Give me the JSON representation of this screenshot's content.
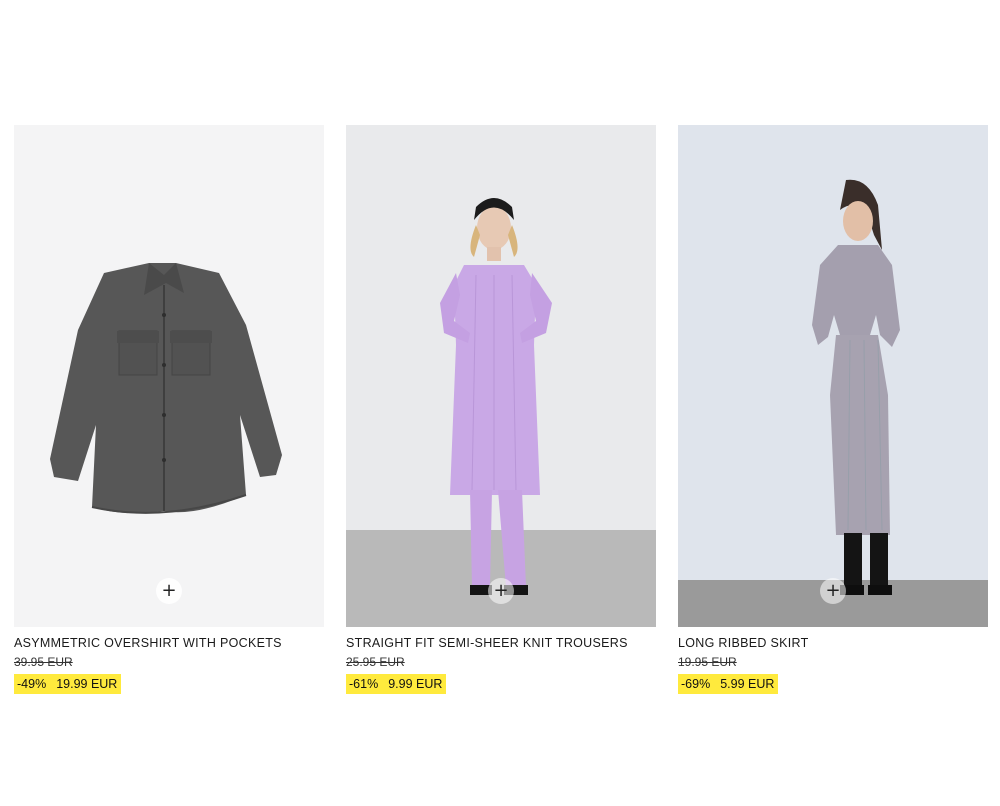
{
  "products": [
    {
      "name": "ASYMMETRIC OVERSHIRT WITH POCKETS",
      "old_price": "39.95 EUR",
      "discount": "-49%",
      "price": "19.99 EUR",
      "image": "grey-overshirt-image",
      "add_label": "+"
    },
    {
      "name": "STRAIGHT FIT SEMI-SHEER KNIT TROUSERS",
      "old_price": "25.95 EUR",
      "discount": "-61%",
      "price": "9.99 EUR",
      "image": "lilac-knit-outfit-image",
      "add_label": "+"
    },
    {
      "name": "LONG RIBBED SKIRT",
      "old_price": "19.95 EUR",
      "discount": "-69%",
      "price": "5.99 EUR",
      "image": "grey-ribbed-set-image",
      "add_label": "+"
    }
  ],
  "colors": {
    "sale_highlight": "#ffea3d",
    "lilac": "#c9a8e6",
    "overshirt": "#575757",
    "ribbed_grey": "#a49fae"
  }
}
